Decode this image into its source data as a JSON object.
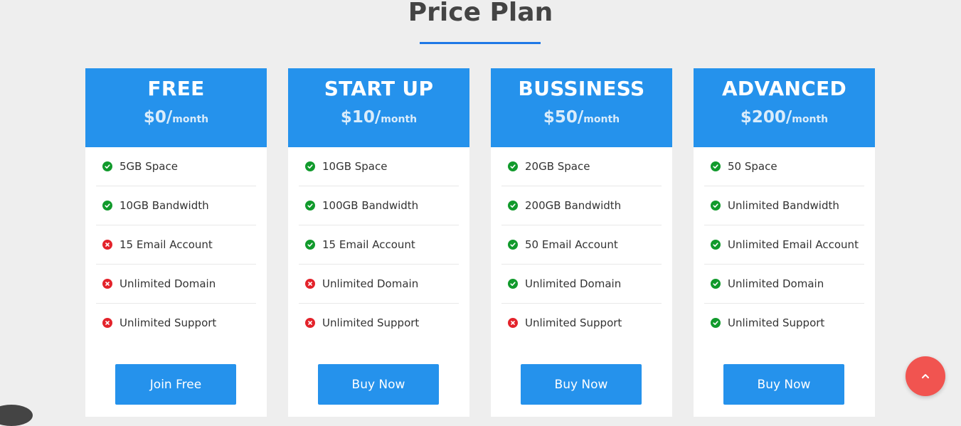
{
  "section": {
    "title": "Price Plan"
  },
  "plans": [
    {
      "name": "FREE",
      "price": "$0/",
      "period": "month",
      "features": [
        {
          "label": "5GB Space",
          "included": true
        },
        {
          "label": "10GB Bandwidth",
          "included": true
        },
        {
          "label": "15 Email Account",
          "included": false
        },
        {
          "label": "Unlimited Domain",
          "included": false
        },
        {
          "label": "Unlimited Support",
          "included": false
        }
      ],
      "button_label": "Join Free"
    },
    {
      "name": "START UP",
      "price": "$10/",
      "period": "month",
      "features": [
        {
          "label": "10GB Space",
          "included": true
        },
        {
          "label": "100GB Bandwidth",
          "included": true
        },
        {
          "label": "15 Email Account",
          "included": true
        },
        {
          "label": "Unlimited Domain",
          "included": false
        },
        {
          "label": "Unlimited Support",
          "included": false
        }
      ],
      "button_label": "Buy Now"
    },
    {
      "name": "BUSSINESS",
      "price": "$50/",
      "period": "month",
      "features": [
        {
          "label": "20GB Space",
          "included": true
        },
        {
          "label": "200GB Bandwidth",
          "included": true
        },
        {
          "label": "50 Email Account",
          "included": true
        },
        {
          "label": "Unlimited Domain",
          "included": true
        },
        {
          "label": "Unlimited Support",
          "included": false
        }
      ],
      "button_label": "Buy Now"
    },
    {
      "name": "ADVANCED",
      "price": "$200/",
      "period": "month",
      "features": [
        {
          "label": "50 Space",
          "included": true
        },
        {
          "label": "Unlimited Bandwidth",
          "included": true
        },
        {
          "label": "Unlimited Email Account",
          "included": true
        },
        {
          "label": "Unlimited Domain",
          "included": true
        },
        {
          "label": "Unlimited Support",
          "included": true
        }
      ],
      "button_label": "Buy Now"
    }
  ],
  "icons": {
    "included": "check-circle-icon",
    "excluded": "x-circle-icon",
    "scroll_top": "chevron-up-icon"
  },
  "colors": {
    "accent": "#2592ec",
    "title_underline": "#1e78e6",
    "check": "#119a2c",
    "cross": "#e3232b",
    "scroll_top": "#f15450",
    "background": "#eeeeee"
  }
}
